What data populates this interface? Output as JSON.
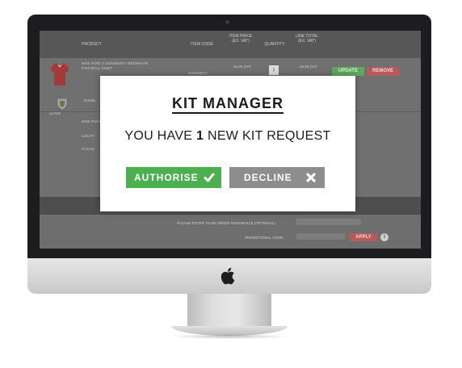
{
  "table": {
    "headers": {
      "product": "PRODUCT",
      "item_code": "ITEM CODE",
      "item_price": "ITEM PRICE (EX. VAT)",
      "quantity": "QUANTITY",
      "line_total": "LINE TOTAL (EX. VAT)"
    },
    "row": {
      "product_name": "NIKE PARK V UNIVERSITY RED/WHITE FOOTBALL SHIRT",
      "item_code": "NA0266572",
      "price": "£8.98 (VAT",
      "quantity": "1",
      "total": "£8.98 (VAT",
      "update_label": "UPDATE",
      "remove_label": "REMOVE",
      "alter_label": "ALTER",
      "overlay_text": "- OVERL",
      "sub_a": "NIKE PAR FOOTBAL",
      "sub_b": "LOCATI",
      "sub_c": "COLOU"
    }
  },
  "footer": {
    "reference_label": "PLEASE ENTER YOUR ORDER REFERENCE (OPTIONAL):",
    "promo_label": "PROMOTIONAL CODE:",
    "apply_label": "APPLY"
  },
  "modal": {
    "title": "KIT MANAGER",
    "message_prefix": "YOU HAVE",
    "message_count": "1",
    "message_suffix": "NEW KIT REQUEST",
    "authorise_label": "AUTHORISE",
    "decline_label": "DECLINE"
  },
  "colors": {
    "authorise": "#4caf50",
    "decline": "#8d8d8d",
    "remove": "#b85a5a",
    "update": "#5ea95e"
  },
  "icons": {
    "authorise": "check-icon",
    "decline": "close-icon",
    "brand": "apple-logo-icon",
    "info": "info-icon"
  }
}
